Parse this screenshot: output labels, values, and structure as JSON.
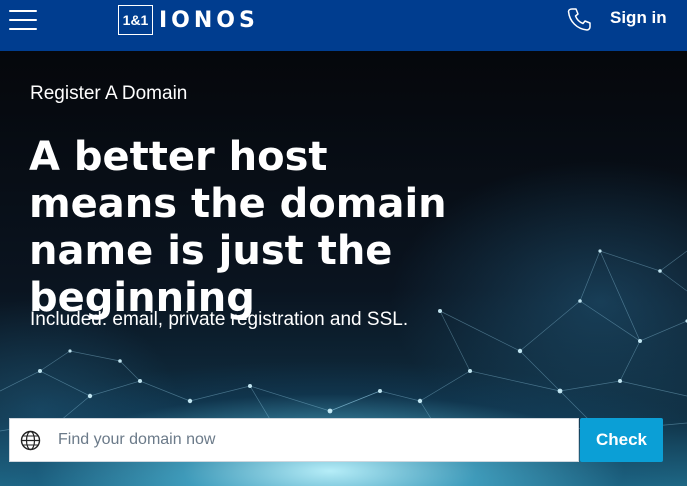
{
  "header": {
    "logo_box_text": "1&1",
    "logo_text": "IONOS",
    "signin_label": "Sign in",
    "menu_icon": "hamburger-menu-icon",
    "phone_icon": "phone-icon"
  },
  "hero": {
    "eyebrow": "Register A Domain",
    "headline": "A better host means the domain name is just the beginning",
    "subline": "Included: email, private registration and SSL."
  },
  "search": {
    "placeholder": "Find your domain now",
    "value": "",
    "icon": "globe-icon",
    "button_label": "Check"
  },
  "colors": {
    "header_bg": "#003d8f",
    "accent": "#0b9fd6"
  }
}
